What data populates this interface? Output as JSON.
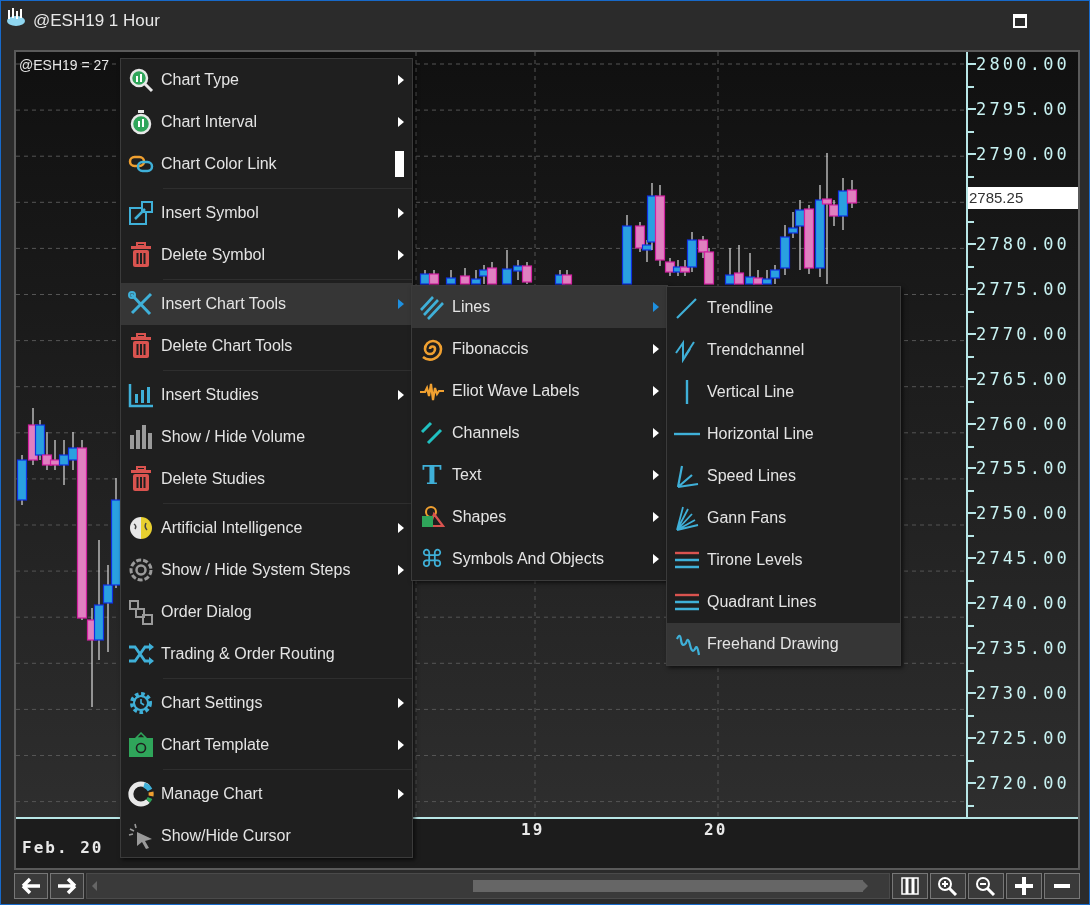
{
  "window": {
    "title": "@ESH19 1 Hour"
  },
  "chart": {
    "symbol_label": "@ESH19 = 27",
    "price_axis": [
      {
        "kind": "tick",
        "label": "2800.00"
      },
      {
        "kind": "tick",
        "label": "2795.00"
      },
      {
        "kind": "tick",
        "label": "2790.00"
      },
      {
        "kind": "current",
        "label": "2785.25"
      },
      {
        "kind": "tick",
        "label": "2780.00"
      },
      {
        "kind": "tick",
        "label": "2775.00"
      },
      {
        "kind": "tick",
        "label": "2770.00"
      },
      {
        "kind": "tick",
        "label": "2765.00"
      },
      {
        "kind": "tick",
        "label": "2760.00"
      },
      {
        "kind": "tick",
        "label": "2755.00"
      },
      {
        "kind": "tick",
        "label": "2750.00"
      },
      {
        "kind": "tick",
        "label": "2745.00"
      },
      {
        "kind": "tick",
        "label": "2740.00"
      },
      {
        "kind": "tick",
        "label": "2735.00"
      },
      {
        "kind": "tick",
        "label": "2730.00"
      },
      {
        "kind": "tick",
        "label": "2725.00"
      },
      {
        "kind": "tick",
        "label": "2720.00"
      }
    ],
    "time_axis": [
      "Feb. 20",
      "19",
      "20"
    ]
  },
  "context_menu": {
    "groups": [
      [
        {
          "label": "Chart Type",
          "kind": "chart-type",
          "submenu": true,
          "selected": false
        },
        {
          "label": "Chart Interval",
          "kind": "interval",
          "submenu": true,
          "selected": false
        },
        {
          "label": "Chart Color Link",
          "kind": "link",
          "submenu": false,
          "selected": false
        }
      ],
      [
        {
          "label": "Insert Symbol",
          "kind": "insert-symbol",
          "submenu": true,
          "selected": false
        },
        {
          "label": "Delete Symbol",
          "kind": "trash",
          "submenu": true,
          "selected": false
        }
      ],
      [
        {
          "label": "Insert Chart Tools",
          "kind": "tools",
          "submenu": true,
          "selected": true
        },
        {
          "label": "Delete Chart Tools",
          "kind": "trash",
          "submenu": false,
          "selected": false
        }
      ],
      [
        {
          "label": "Insert Studies",
          "kind": "studies",
          "submenu": true,
          "selected": false
        },
        {
          "label": "Show / Hide Volume",
          "kind": "volume",
          "submenu": false,
          "selected": false
        },
        {
          "label": "Delete Studies",
          "kind": "trash",
          "submenu": false,
          "selected": false
        }
      ],
      [
        {
          "label": "Artificial Intelligence",
          "kind": "brain",
          "submenu": true,
          "selected": false
        },
        {
          "label": "Show / Hide System Steps",
          "kind": "steps",
          "submenu": true,
          "selected": false
        },
        {
          "label": "Order Dialog",
          "kind": "order",
          "submenu": false,
          "selected": false
        },
        {
          "label": "Trading & Order Routing",
          "kind": "shuffle",
          "submenu": false,
          "selected": false
        }
      ],
      [
        {
          "label": "Chart Settings",
          "kind": "settings",
          "submenu": true,
          "selected": false
        },
        {
          "label": "Chart Template",
          "kind": "template",
          "submenu": true,
          "selected": false
        }
      ],
      [
        {
          "label": "Manage Chart",
          "kind": "manage",
          "submenu": true,
          "selected": false
        },
        {
          "label": "Show/Hide Cursor",
          "kind": "cursor",
          "submenu": false,
          "selected": false
        }
      ]
    ]
  },
  "chart_tools_menu": {
    "items": [
      {
        "label": "Lines",
        "kind": "lines",
        "submenu": true,
        "selected": true
      },
      {
        "label": "Fibonaccis",
        "kind": "spiral",
        "submenu": true,
        "selected": false
      },
      {
        "label": "Eliot Wave Labels",
        "kind": "wave",
        "submenu": true,
        "selected": false
      },
      {
        "label": "Channels",
        "kind": "channels",
        "submenu": true,
        "selected": false
      },
      {
        "label": "Text",
        "kind": "text",
        "glyph": "T",
        "submenu": true,
        "selected": false
      },
      {
        "label": "Shapes",
        "kind": "shapes",
        "submenu": true,
        "selected": false
      },
      {
        "label": "Symbols And Objects",
        "kind": "symbols",
        "glyph": "⌘",
        "submenu": true,
        "selected": false
      }
    ]
  },
  "lines_menu": {
    "items": [
      {
        "label": "Trendline",
        "kind": "trendline",
        "submenu": false,
        "selected": false
      },
      {
        "label": "Trendchannel",
        "kind": "zigzag",
        "submenu": false,
        "selected": false
      },
      {
        "label": "Vertical Line",
        "kind": "vline",
        "submenu": false,
        "selected": false
      },
      {
        "label": "Horizontal Line",
        "kind": "hline",
        "submenu": false,
        "selected": false
      },
      {
        "label": "Speed Lines",
        "kind": "speed",
        "submenu": false,
        "selected": false
      },
      {
        "label": "Gann Fans",
        "kind": "fan",
        "submenu": false,
        "selected": false
      },
      {
        "label": "Tirone Levels",
        "kind": "levels",
        "submenu": false,
        "selected": false
      },
      {
        "label": "Quadrant Lines",
        "kind": "levels",
        "submenu": false,
        "selected": false
      },
      {
        "label": "Freehand Drawing",
        "kind": "squiggle",
        "submenu": false,
        "selected": true
      }
    ]
  }
}
